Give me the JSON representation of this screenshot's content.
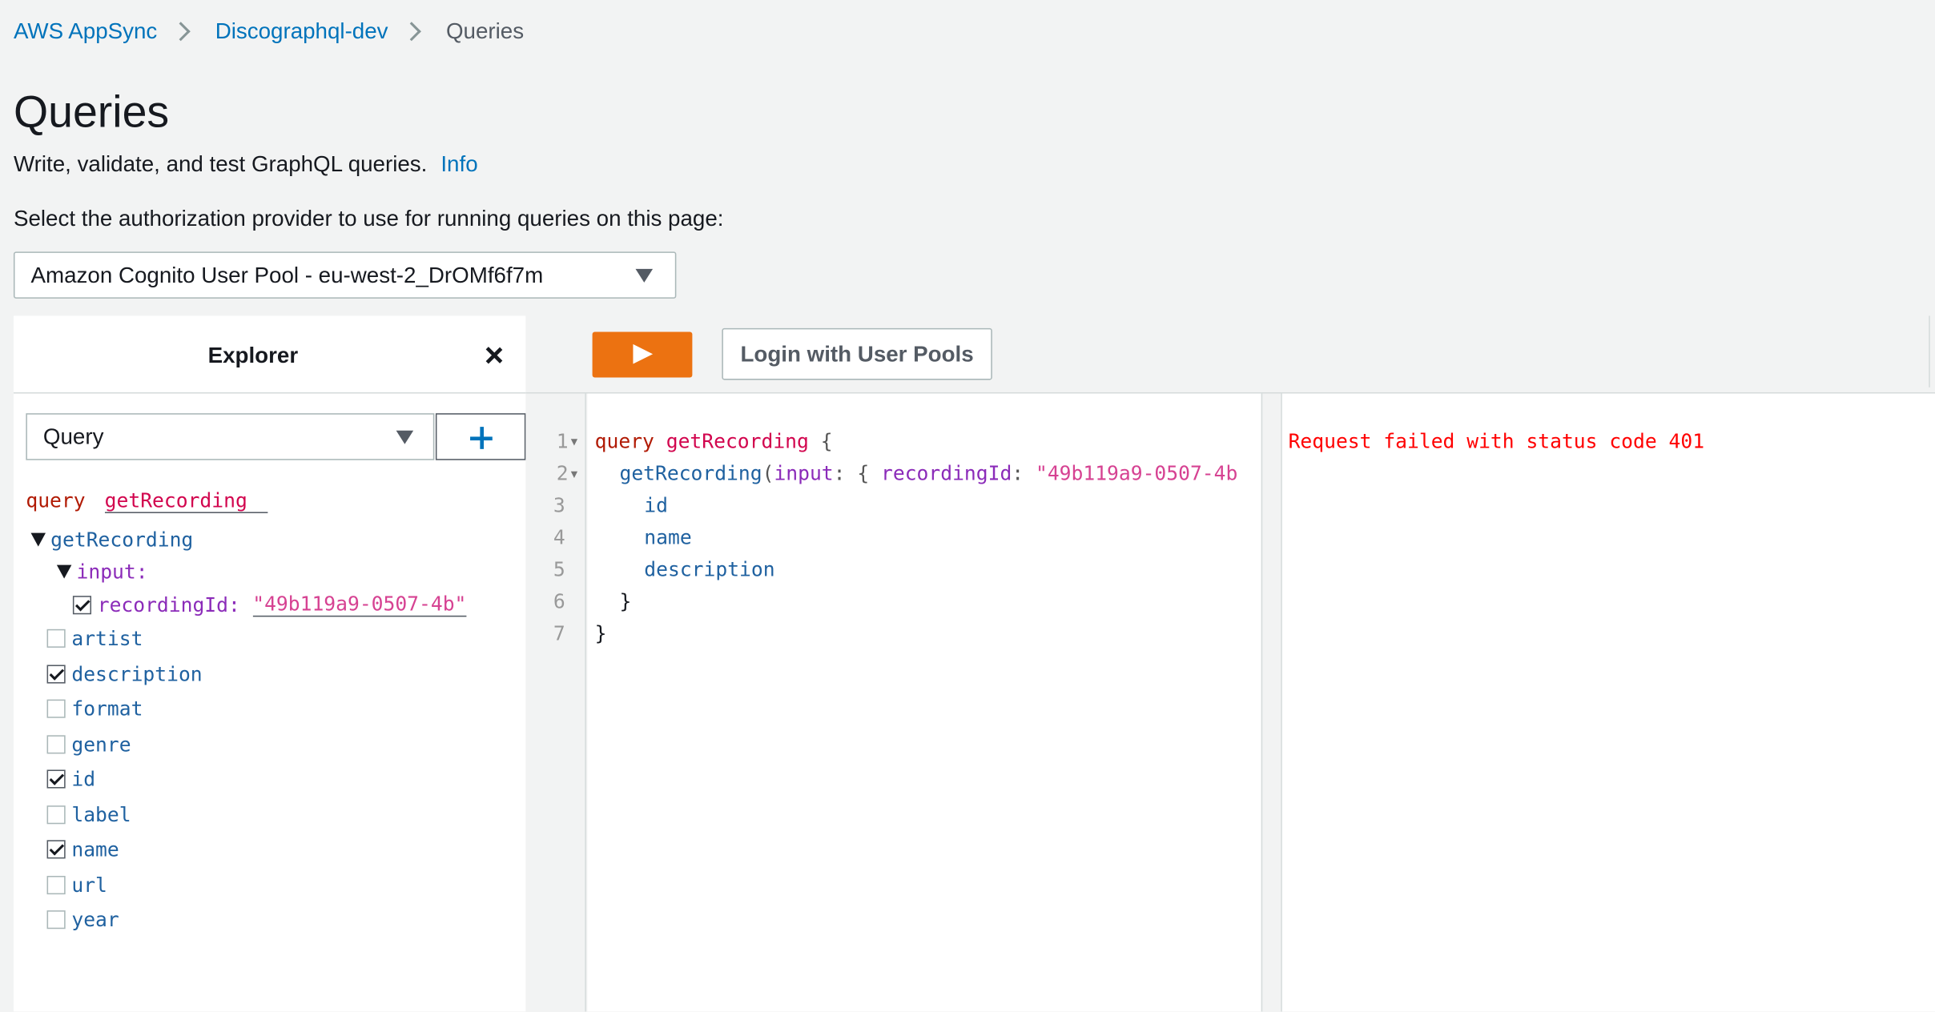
{
  "breadcrumb": {
    "items": [
      "AWS AppSync",
      "Discographql-dev",
      "Queries"
    ]
  },
  "page": {
    "title": "Queries",
    "subtitle": "Write, validate, and test GraphQL queries.",
    "info_link": "Info",
    "auth_label": "Select the authorization provider to use for running queries on this page:",
    "auth_selected": "Amazon Cognito User Pool - eu-west-2_DrOMf6f7m"
  },
  "explorer": {
    "title": "Explorer",
    "operation_type": "Query",
    "query_keyword": "query",
    "operation_name": "getRecording",
    "root_field": "getRecording",
    "input_label": "input:",
    "input_arg_label": "recordingId:",
    "input_arg_value": "\"49b119a9-0507-4b\"",
    "fields": [
      {
        "name": "artist",
        "checked": false
      },
      {
        "name": "description",
        "checked": true
      },
      {
        "name": "format",
        "checked": false
      },
      {
        "name": "genre",
        "checked": false
      },
      {
        "name": "id",
        "checked": true
      },
      {
        "name": "label",
        "checked": false
      },
      {
        "name": "name",
        "checked": true
      },
      {
        "name": "url",
        "checked": false
      },
      {
        "name": "year",
        "checked": false
      }
    ]
  },
  "toolbar": {
    "login_label": "Login with User Pools"
  },
  "editor": {
    "line_numbers": [
      "1",
      "2",
      "3",
      "4",
      "5",
      "6",
      "7"
    ],
    "line1": {
      "kw": "query",
      "name": "getRecording",
      "brace": "{"
    },
    "line2": {
      "field": "getRecording",
      "open": "(",
      "arg": "input",
      "mid": ": { ",
      "key": "recordingId",
      "colon": ": ",
      "value": "\"49b119a9-0507-4b"
    },
    "line3": "id",
    "line4": "name",
    "line5": "description",
    "line6": "}",
    "line7": "}"
  },
  "result": {
    "error": "Request failed with status code 401"
  },
  "colors": {
    "accent_link": "#0073bb",
    "run_button": "#ec7211",
    "error": "#ff0000"
  }
}
